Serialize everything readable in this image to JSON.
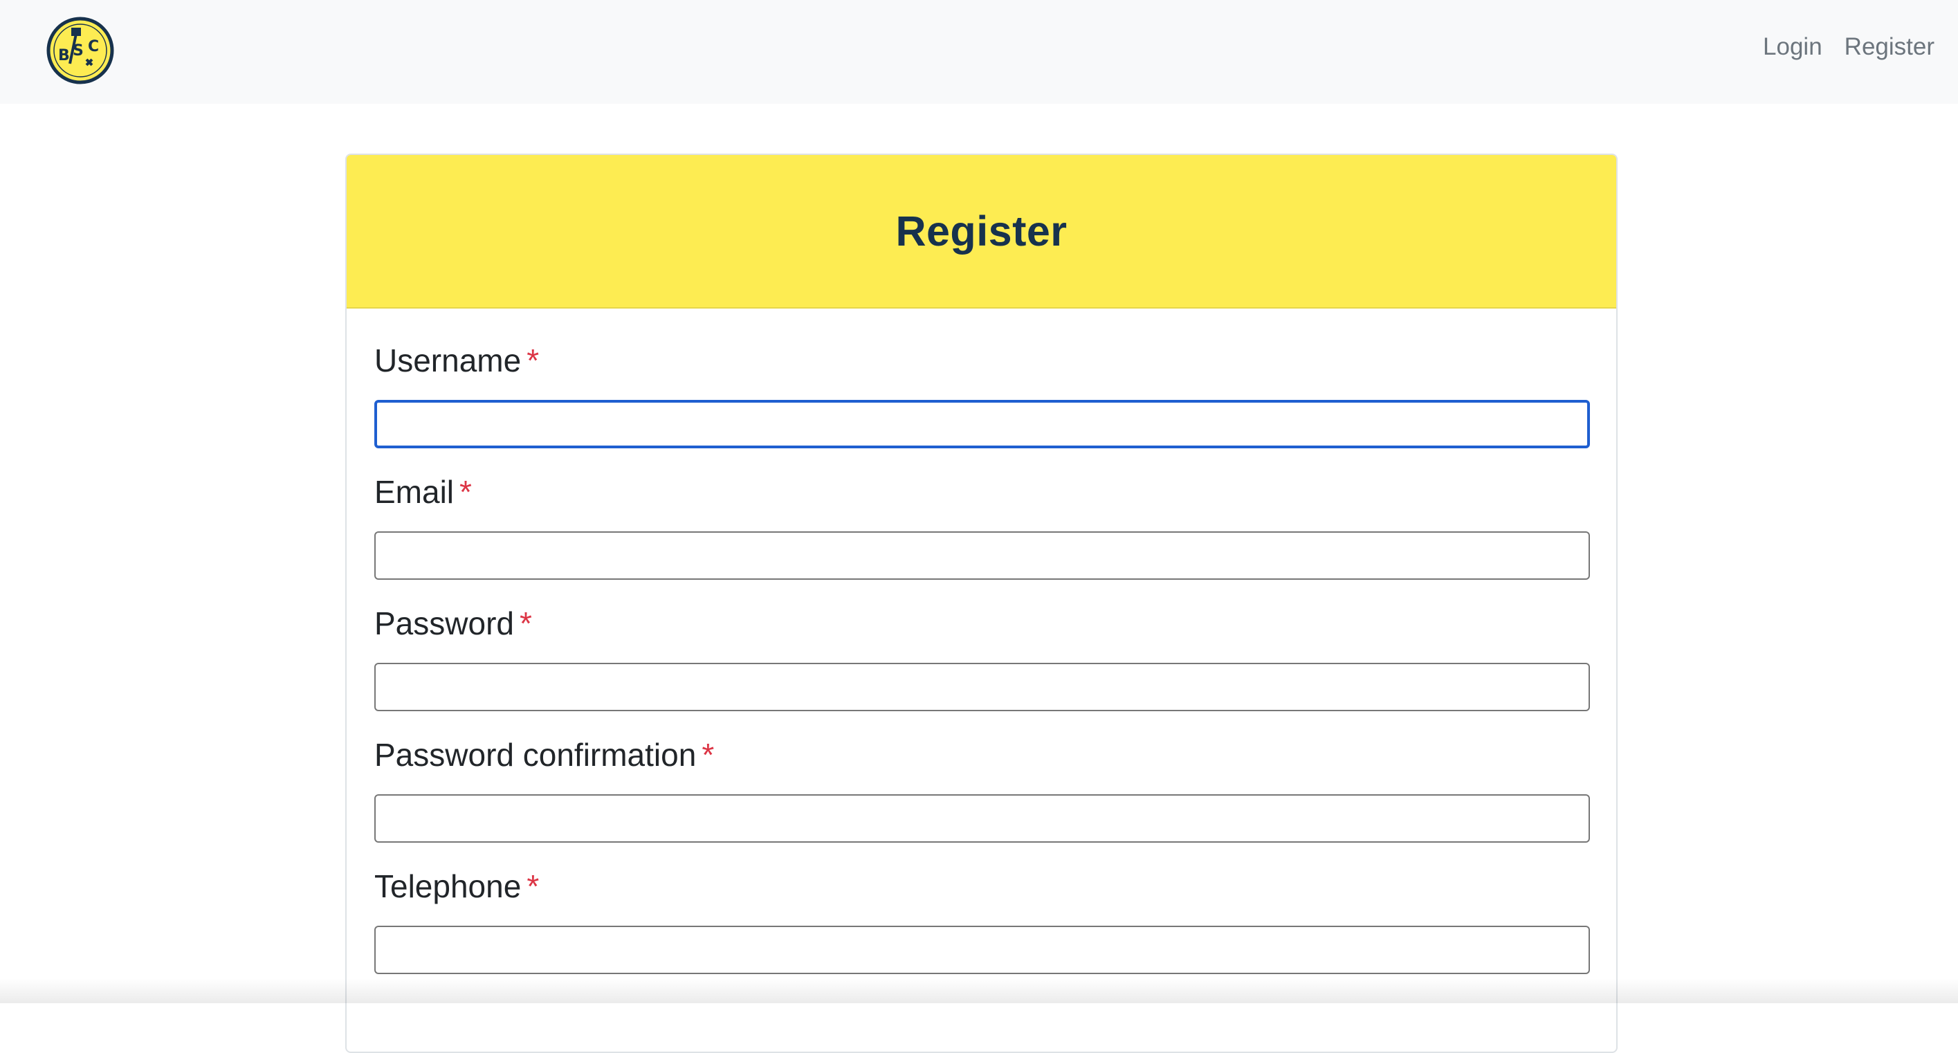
{
  "navbar": {
    "logo": {
      "text": "BSC",
      "ring_color": "#17324d",
      "fill_color": "#fdec52"
    },
    "links": [
      {
        "label": "Login"
      },
      {
        "label": "Register"
      }
    ]
  },
  "form": {
    "title": "Register",
    "header_color": "#fdec52",
    "required_marker": "*",
    "fields": [
      {
        "label": "Username",
        "value": "",
        "placeholder": "",
        "type": "text",
        "focused": true
      },
      {
        "label": "Email",
        "value": "",
        "placeholder": "",
        "type": "email",
        "focused": false
      },
      {
        "label": "Password",
        "value": "",
        "placeholder": "",
        "type": "password",
        "focused": false
      },
      {
        "label": "Password confirmation",
        "value": "",
        "placeholder": "",
        "type": "password",
        "focused": false
      },
      {
        "label": "Telephone",
        "value": "",
        "placeholder": "",
        "type": "tel",
        "focused": false
      }
    ]
  }
}
